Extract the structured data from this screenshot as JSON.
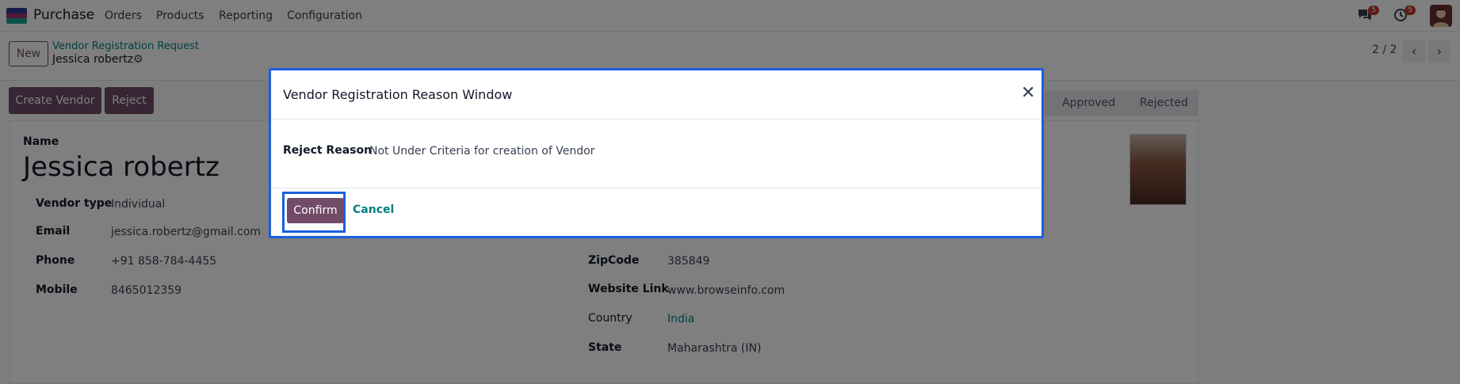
{
  "navbar": {
    "app_name": "Purchase",
    "menu": [
      "Orders",
      "Products",
      "Reporting",
      "Configuration"
    ],
    "messages_count": "5",
    "activities_count": "5"
  },
  "control": {
    "new_label": "New",
    "breadcrumb_parent": "Vendor Registration Request",
    "breadcrumb_current": "Jessica robertz",
    "pager": "2 / 2"
  },
  "statusbar": {
    "create_vendor_label": "Create Vendor",
    "reject_label": "Reject",
    "stages": [
      "Approved",
      "Rejected"
    ]
  },
  "form": {
    "name_label": "Name",
    "name_value": "Jessica robertz",
    "left_fields": [
      {
        "label": "Vendor type",
        "value": "Individual"
      },
      {
        "label": "Email",
        "value": "jessica.robertz@gmail.com"
      },
      {
        "label": "Phone",
        "value": "+91 858-784-4455"
      },
      {
        "label": "Mobile",
        "value": "8465012359"
      }
    ],
    "right_fields": [
      {
        "label": "ZipCode",
        "value": "385849"
      },
      {
        "label": "Website Link",
        "value": "www.browseinfo.com"
      },
      {
        "label": "Country",
        "value": "India"
      },
      {
        "label": "State",
        "value": "Maharashtra (IN)"
      }
    ]
  },
  "modal": {
    "title": "Vendor Registration Reason Window",
    "reason_label": "Reject Reason",
    "reason_value": "Not Under Criteria for creation of Vendor",
    "confirm_label": "Confirm",
    "cancel_label": "Cancel"
  },
  "colors": {
    "primary": "#714B67",
    "link": "#017e84",
    "focus": "#1a5fe0"
  }
}
